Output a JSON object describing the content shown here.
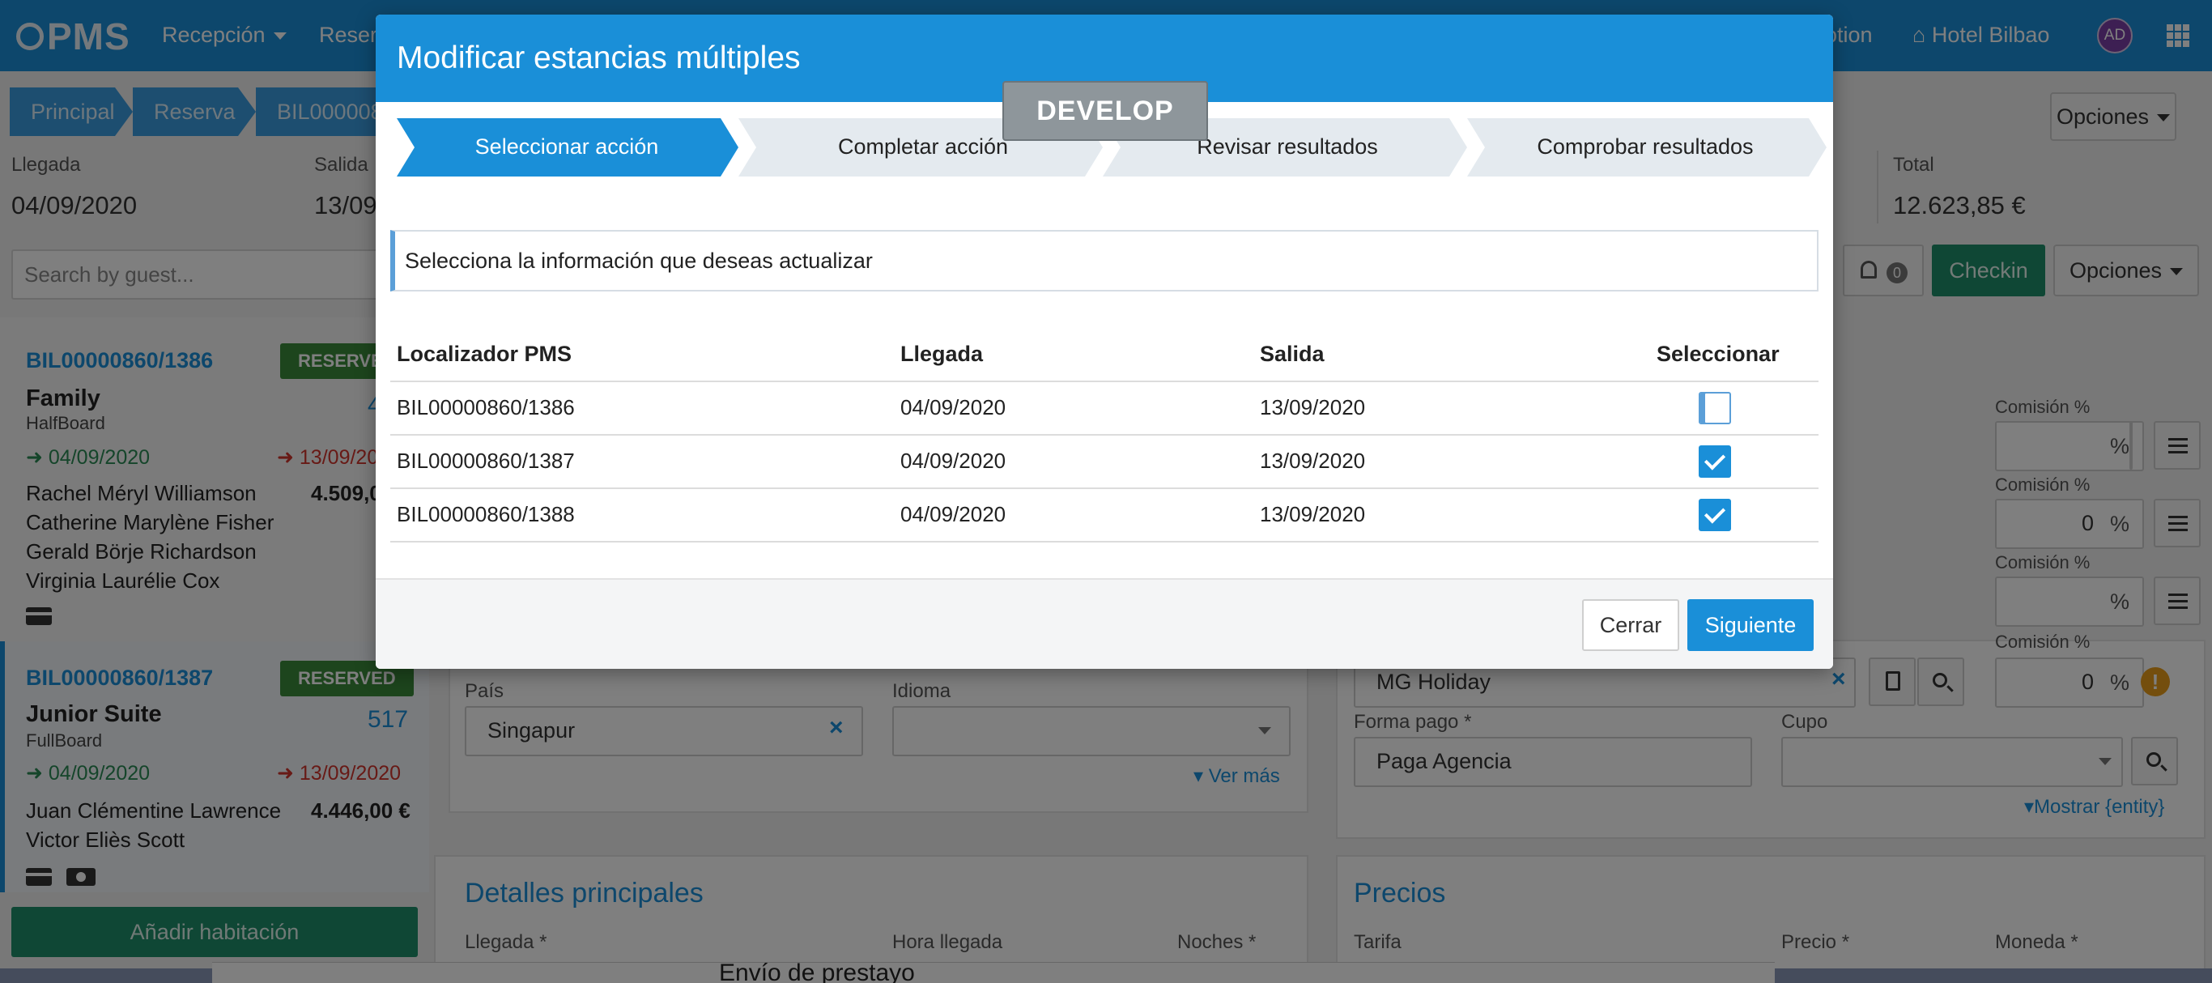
{
  "nav": {
    "logo_text": "PMS",
    "items": [
      {
        "label": "Recepción"
      },
      {
        "label": "Reserv"
      },
      {
        "label": "otion"
      },
      {
        "label": "Hotel Bilbao"
      }
    ],
    "avatar_initials": "AD"
  },
  "breadcrumb": [
    "Principal",
    "Reserva",
    "BIL000008"
  ],
  "header": {
    "options_label": "Opciones",
    "arrival_label": "Llegada",
    "arrival_value": "04/09/2020",
    "departure_label": "Salida",
    "departure_value": "13/09",
    "total_label": "Total",
    "total_value": "12.623,85 €"
  },
  "search": {
    "placeholder": "Search by guest..."
  },
  "toolbar": {
    "notifications_count": "0",
    "checkin_label": "Checkin",
    "options_label": "Opciones"
  },
  "reservations": [
    {
      "id": "BIL00000860/1386",
      "status": "RESERVE",
      "room_type": "Family",
      "board": "HalfBoard",
      "room_number": "4",
      "checkin": "04/09/2020",
      "checkout": "13/09/20",
      "amount": "4.509,0",
      "guests": [
        "Rachel Méryl Williamson",
        "Catherine Marylène Fisher",
        "Gerald Börje Richardson",
        "Virginia Laurélie Cox"
      ]
    },
    {
      "id": "BIL00000860/1387",
      "status": "RESERVED",
      "room_type": "Junior Suite",
      "board": "FullBoard",
      "room_number": "517",
      "checkin": "04/09/2020",
      "checkout": "13/09/2020",
      "amount": "4.446,00 €",
      "guests": [
        "Juan Clémentine Lawrence",
        "Victor Eliès Scott"
      ]
    }
  ],
  "add_room_label": "Añadir habitación",
  "form": {
    "country_label": "País",
    "country_value": "Singapur",
    "language_label": "Idioma",
    "language_value": "",
    "see_more": "Ver más",
    "agency_value": "MG Holiday",
    "payment_label": "Forma pago *",
    "payment_value": "Paga Agencia",
    "quota_label": "Cupo",
    "show_entity": "Mostrar {entity}",
    "commission_label": "Comisión %",
    "commission_values": [
      "",
      "0",
      "",
      "0"
    ],
    "percent_sign": "%",
    "main_details_title": "Detalles principales",
    "arrival_label": "Llegada *",
    "arrival_time_label": "Hora llegada",
    "nights_label": "Noches *",
    "prices_title": "Precios",
    "rate_label": "Tarifa",
    "price_label": "Precio *",
    "currency_label": "Moneda *"
  },
  "bottom_doc_text": "Envío de prestayo",
  "modal": {
    "title": "Modificar estancias múltiples",
    "env_badge": "DEVELOP",
    "steps": [
      {
        "label": "Seleccionar acción",
        "active": true
      },
      {
        "label": "Completar acción",
        "active": false
      },
      {
        "label": "Revisar resultados",
        "active": false
      },
      {
        "label": "Comprobar resultados",
        "active": false
      }
    ],
    "info_text": "Selecciona la información que deseas actualizar",
    "columns": [
      "Localizador PMS",
      "Llegada",
      "Salida",
      "Seleccionar"
    ],
    "rows": [
      {
        "locator": "BIL00000860/1386",
        "arrival": "04/09/2020",
        "departure": "13/09/2020",
        "selected": false
      },
      {
        "locator": "BIL00000860/1387",
        "arrival": "04/09/2020",
        "departure": "13/09/2020",
        "selected": true
      },
      {
        "locator": "BIL00000860/1388",
        "arrival": "04/09/2020",
        "departure": "13/09/2020",
        "selected": true
      }
    ],
    "close_label": "Cerrar",
    "next_label": "Siguiente"
  },
  "colors": {
    "brand": "#1a8fd8",
    "success": "#1e8f6a",
    "reserved_badge": "#3a8a3a",
    "checkout_red": "#d0342c",
    "checkin_green": "#2a8a55"
  }
}
